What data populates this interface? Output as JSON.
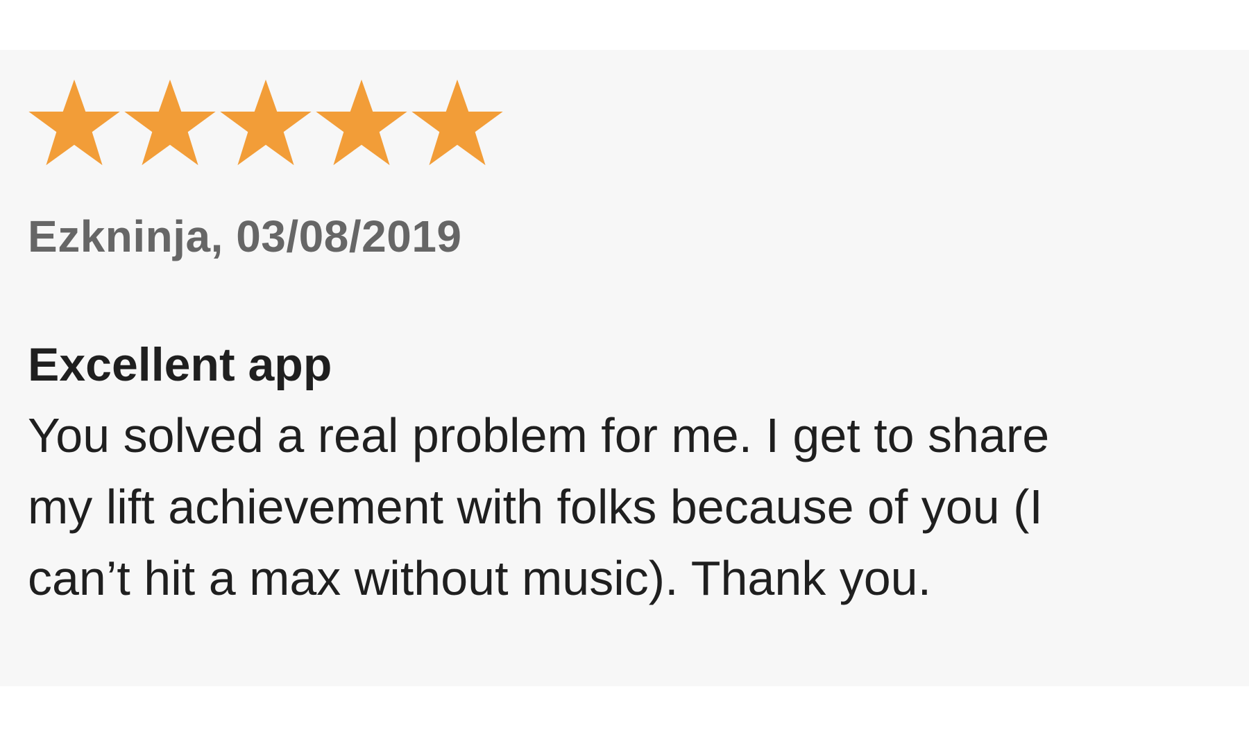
{
  "review": {
    "rating": 5,
    "rating_max": 5,
    "star_color": "#f29d38",
    "star_icon": "star-icon",
    "author": "Ezkninja",
    "date": "03/08/2019",
    "author_line": "Ezkninja, 03/08/2019",
    "title": "Excellent app",
    "body_lines": [
      "You solved a real problem for me. I get to share",
      "my lift achievement with folks because of you (I",
      "can’t hit a max without music). Thank you."
    ]
  },
  "colors": {
    "card_background": "#f7f7f7",
    "page_background": "#ffffff",
    "author_text": "#666666",
    "body_text": "#1f1f1f"
  }
}
